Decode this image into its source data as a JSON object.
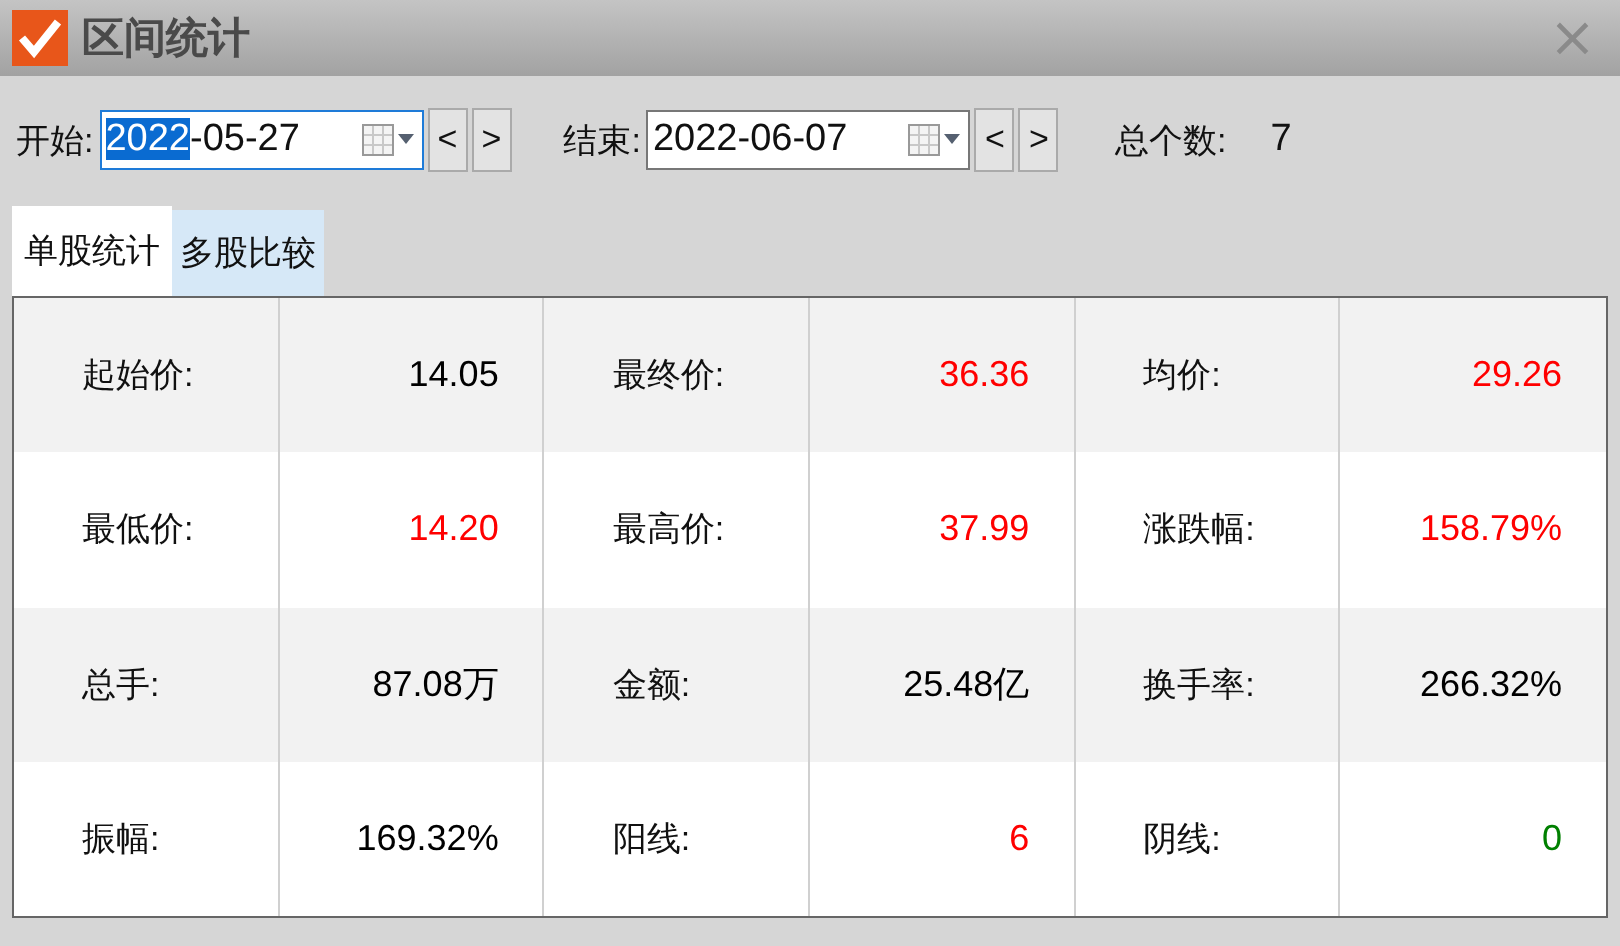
{
  "window": {
    "title": "区间统计",
    "close": "×"
  },
  "range": {
    "start": {
      "label": "开始:",
      "parts": [
        {
          "text": "2022",
          "selected": true
        },
        {
          "text": "-05-27",
          "selected": false
        }
      ],
      "prev": "<",
      "next": ">"
    },
    "end": {
      "label": "结束:",
      "parts": [
        {
          "text": "2022-06-07",
          "selected": false
        }
      ],
      "prev": "<",
      "next": ">"
    },
    "count_label": "总个数:",
    "count": "7"
  },
  "tabs": [
    {
      "label": "单股统计",
      "selected": true
    },
    {
      "label": "多股比较",
      "selected": false
    }
  ],
  "table": {
    "rows": [
      {
        "cells": [
          {
            "label": "起始价:",
            "value": "14.05",
            "color": "#000000"
          },
          {
            "label": "最终价:",
            "value": "36.36",
            "color": "#ff0000"
          },
          {
            "label": "均价:",
            "value": "29.26",
            "color": "#ff0000"
          }
        ]
      },
      {
        "cells": [
          {
            "label": "最低价:",
            "value": "14.20",
            "color": "#ff0000"
          },
          {
            "label": "最高价:",
            "value": "37.99",
            "color": "#ff0000"
          },
          {
            "label": "涨跌幅:",
            "value": "158.79%",
            "color": "#ff0000"
          }
        ]
      },
      {
        "cells": [
          {
            "label": "总手:",
            "value": "87.08万",
            "color": "#000000"
          },
          {
            "label": "金额:",
            "value": "25.48亿",
            "color": "#000000"
          },
          {
            "label": "换手率:",
            "value": "266.32%",
            "color": "#000000"
          }
        ]
      },
      {
        "cells": [
          {
            "label": "振幅:",
            "value": "169.32%",
            "color": "#000000"
          },
          {
            "label": "阳线:",
            "value": "6",
            "color": "#ff0000"
          },
          {
            "label": "阴线:",
            "value": "0",
            "color": "#008000"
          }
        ]
      }
    ]
  }
}
